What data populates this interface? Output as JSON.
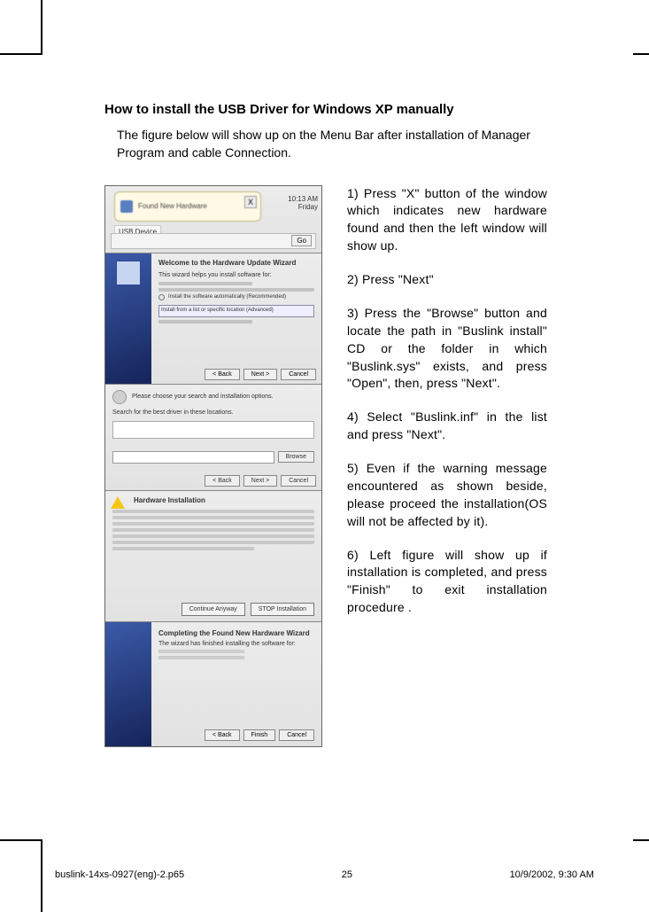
{
  "heading": "How to install the USB Driver for Windows XP manually",
  "intro": "The figure below will show up on the Menu Bar after installation of Manager Program and cable Connection.",
  "figure": {
    "balloon_title": "Found New Hardware",
    "balloon_close": "X",
    "device_label": "USB Device",
    "go_label": "Go",
    "time": "10:13 AM",
    "day": "Friday",
    "wizard_title": "Welcome to the Hardware Update Wizard",
    "wizard_sub": "This wizard helps you install software for:",
    "wizard_radio1": "Install the software automatically (Recommended)",
    "wizard_radio2": "Install from a list or specific location (Advanced)",
    "wizard_btn_back": "< Back",
    "wizard_btn_next": "Next >",
    "wizard_btn_cancel": "Cancel",
    "browse_hdr": "Please choose your search and installation options.",
    "browse_text": "Search for the best driver in these locations.",
    "browse_btn": "Browse",
    "warn_title": "Hardware Installation",
    "warn_body": "The software you are installing for this hardware has not passed Windows Logo testing to verify its compatibility with Windows XP. Continuing your installation of this software may impair or destabilize the correct operation of your system either immediately or in the future.",
    "warn_continue": "Continue Anyway",
    "warn_stop": "STOP Installation",
    "finish_title": "Completing the Found New Hardware Wizard",
    "finish_sub": "The wizard has finished installing the software for:",
    "finish_btn": "Finish"
  },
  "steps": {
    "s1": "1) Press \"X\" button of the window which indicates new hardware found and then the left window will show up.",
    "s2": "2) Press \"Next\"",
    "s3": "3) Press the \"Browse\" button and locate the path in \"Buslink install\" CD or the  folder in which  \"Buslink.sys\" exists, and press \"Open\", then, press \"Next\".",
    "s4": "4) Select \"Buslink.inf\"  in the list and press \"Next\".",
    "s5": "5) Even if the warning message encountered as shown beside, please proceed the installation(OS will not be affected by it).",
    "s6": "6) Left figure will show up if installation is completed, and press \"Finish\" to exit installation procedure ."
  },
  "footer": {
    "file": "buslink-14xs-0927(eng)-2.p65",
    "page": "25",
    "datetime": "10/9/2002, 9:30 AM"
  }
}
